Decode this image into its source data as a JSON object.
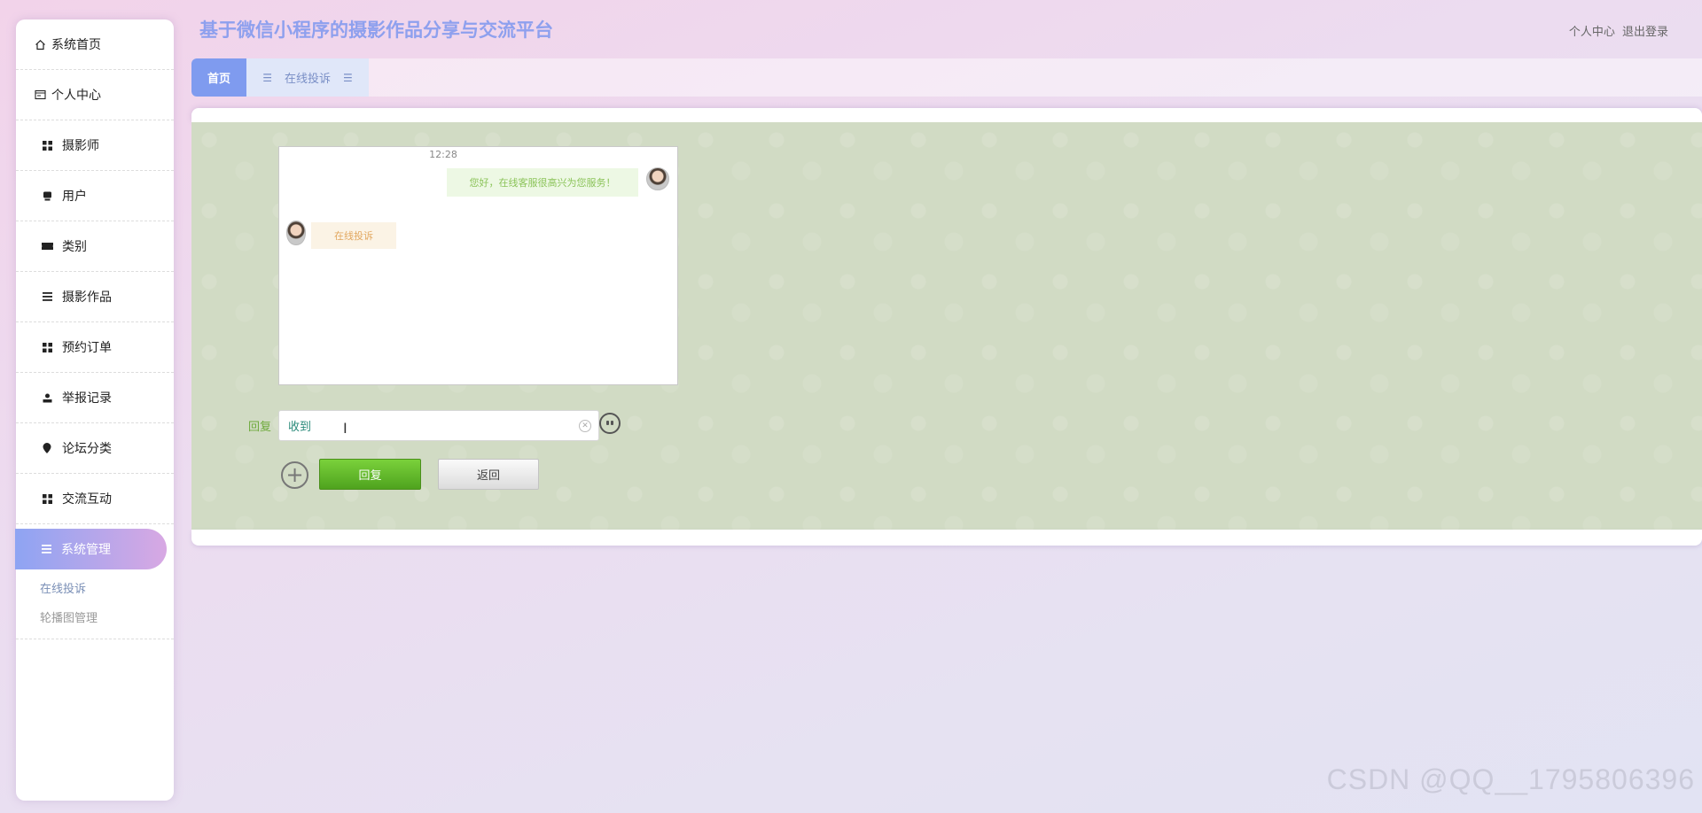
{
  "header": {
    "title": "基于微信小程序的摄影作品分享与交流平台",
    "links": [
      "个人中心",
      "退出登录"
    ]
  },
  "sidebar": {
    "items": [
      {
        "label": "系统首页",
        "icon": "home-icon"
      },
      {
        "label": "个人中心",
        "icon": "profile-card-icon"
      },
      {
        "label": "摄影师",
        "icon": "grid-icon"
      },
      {
        "label": "用户",
        "icon": "user-icon"
      },
      {
        "label": "类别",
        "icon": "ticket-icon"
      },
      {
        "label": "摄影作品",
        "icon": "list-icon"
      },
      {
        "label": "预约订单",
        "icon": "grid-icon"
      },
      {
        "label": "举报记录",
        "icon": "person-icon"
      },
      {
        "label": "论坛分类",
        "icon": "pin-icon"
      },
      {
        "label": "交流互动",
        "icon": "grid-icon"
      },
      {
        "label": "系统管理",
        "icon": "list-icon"
      }
    ],
    "submenu": [
      "在线投诉",
      "轮播图管理"
    ]
  },
  "tabs": {
    "home": "首页",
    "current": "在线投诉"
  },
  "chat": {
    "time": "12:28",
    "messages": [
      {
        "side": "right",
        "text": "您好，在线客服很高兴为您服务！"
      },
      {
        "side": "left",
        "text": "在线投诉"
      }
    ]
  },
  "reply": {
    "label": "回复",
    "value": "收到",
    "submit_label": "回复",
    "back_label": "返回"
  },
  "watermark": "CSDN @QQ__1795806396",
  "colors": {
    "accent": "#7f9bef",
    "active_gradient_end": "#d8a8e3",
    "submit_green": "#5fb82a",
    "chat_bg": "#d1dbc4"
  }
}
